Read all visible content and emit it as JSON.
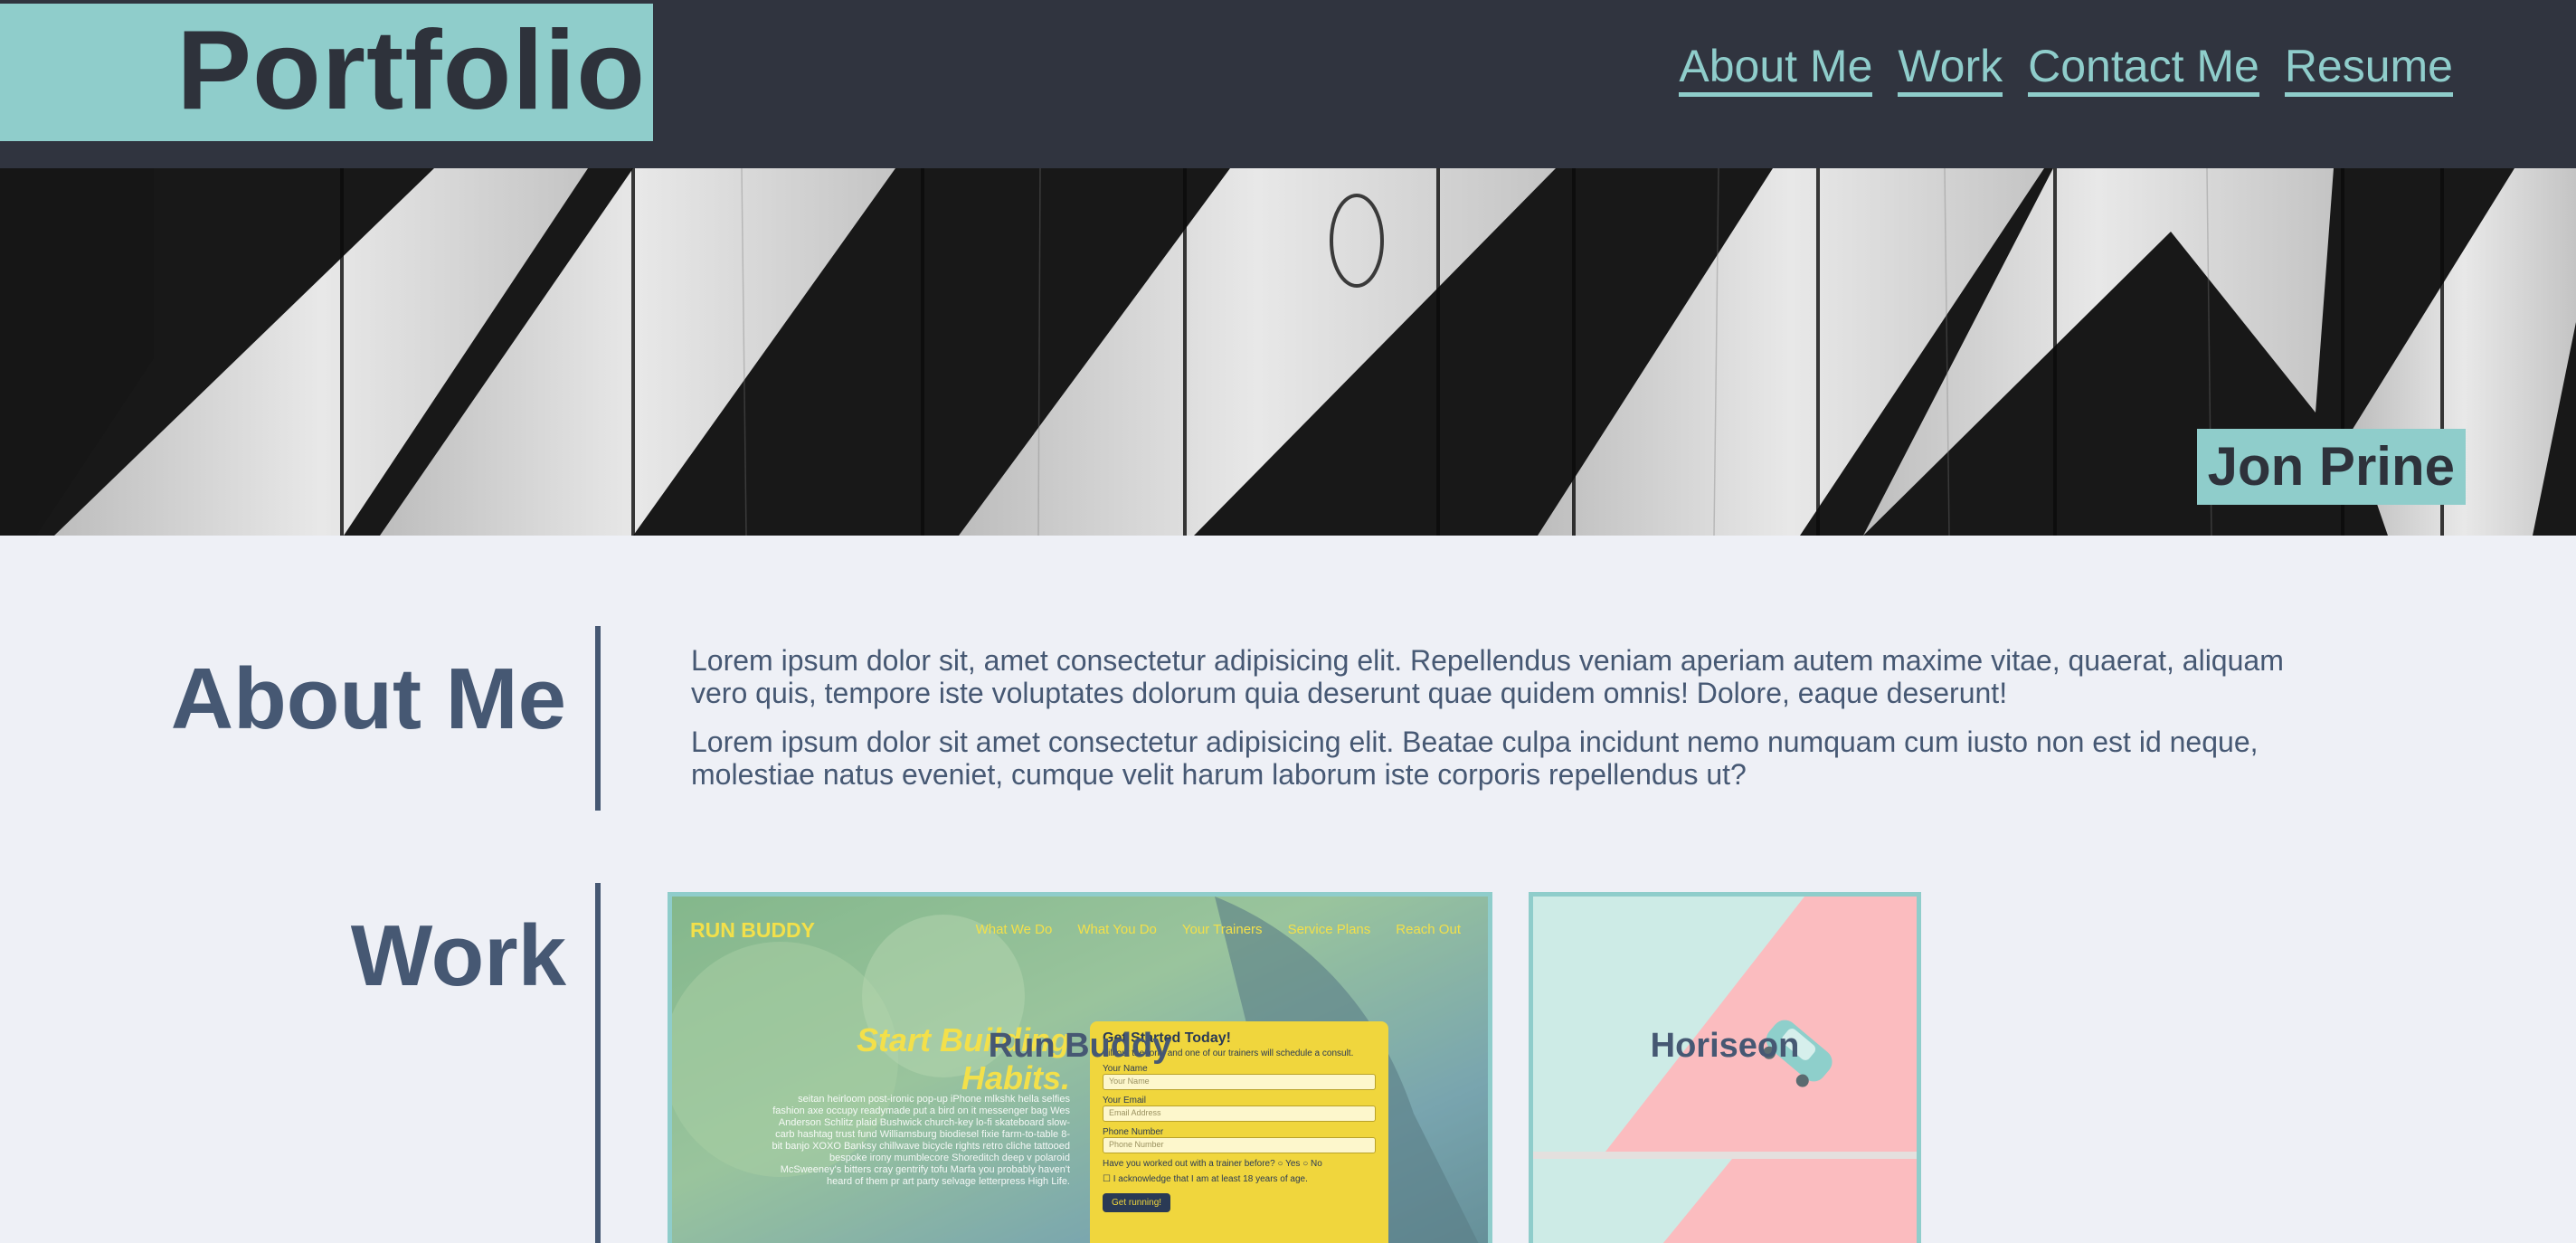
{
  "header": {
    "logo": "Portfolio",
    "nav": [
      "About Me",
      "Work",
      "Contact Me",
      "Resume"
    ]
  },
  "hero": {
    "name": "Jon Prine"
  },
  "about": {
    "title": "About Me",
    "paragraphs": [
      "Lorem ipsum dolor sit, amet consectetur adipisicing elit. Repellendus veniam aperiam autem maxime vitae, quaerat, aliquam vero quis, tempore iste voluptates dolorum quia deserunt quae quidem omnis! Dolore, eaque deserunt!",
      "Lorem ipsum dolor sit amet consectetur adipisicing elit. Beatae culpa incidunt nemo numquam cum iusto non est id neque, molestiae natus eveniet, cumque velit harum laborum iste corporis repellendus ut?"
    ]
  },
  "work": {
    "title": "Work",
    "projects": [
      {
        "name": "Run Buddy",
        "screenshot": {
          "brand": "RUN BUDDY",
          "nav": [
            "What We Do",
            "What You Do",
            "Your Trainers",
            "Service Plans",
            "Reach Out"
          ],
          "headline_1": "Start Building",
          "headline_2": "Habits.",
          "copy": "seitan heirloom post-ironic pop-up iPhone mlkshk hella selfies fashion axe occupy readymade put a bird on it messenger bag Wes Anderson Schlitz plaid Bushwick church-key lo-fi skateboard slow-carb hashtag trust fund Williamsburg biodiesel fixie farm-to-table 8-bit banjo XOXO Banksy chillwave bicycle rights retro cliche tattooed bespoke irony mumblecore Shoreditch deep v polaroid McSweeney's bitters cray gentrify tofu Marfa you probably haven't heard of them pr art party selvage letterpress High Life.",
          "form_title": "Get Started Today!",
          "form_subtitle": "Fill out the form and one of our trainers will schedule a consult.",
          "label_name": "Your Name",
          "placeholder_name": "Your Name",
          "label_email": "Your Email",
          "placeholder_email": "Email Address",
          "label_phone": "Phone Number",
          "placeholder_phone": "Phone Number",
          "question": "Have you worked out with a trainer before?",
          "opt_yes": "Yes",
          "opt_no": "No",
          "ack": "I acknowledge that I am at least 18 years of age.",
          "button": "Get running!"
        }
      },
      {
        "name": "Horiseon"
      }
    ]
  },
  "colors": {
    "header_bg": "#30343f",
    "accent": "#8fcdcb",
    "heading": "#465873",
    "page_bg": "#eef0f6"
  }
}
